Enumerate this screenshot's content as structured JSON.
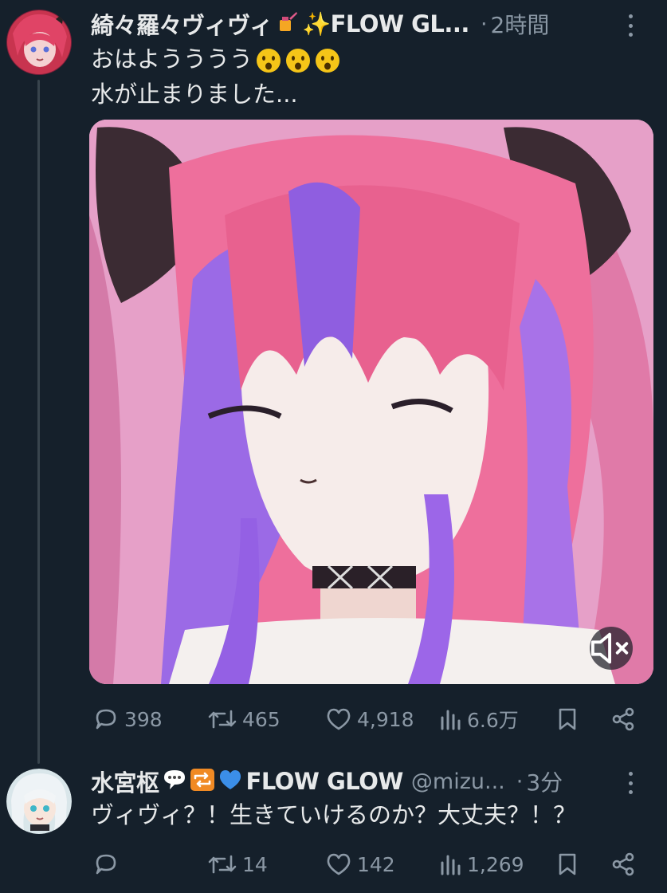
{
  "tweets": [
    {
      "display_name": "綺々羅々ヴィヴィ",
      "display_name_tail": "✨FLOW GL...",
      "handle": "",
      "dot": "·",
      "time": "2時間",
      "text_line1": "おはようううう",
      "text_line2": "水が止まりました...",
      "stats": {
        "replies": "398",
        "retweets": "465",
        "likes": "4,918",
        "views": "6.6万"
      }
    },
    {
      "display_name": "水宮枢",
      "display_name_tail": "FLOW GLOW",
      "handle": "@mizu...",
      "dot": "·",
      "time": "3分",
      "text_line1": "ヴィヴィ？！生きていけるのか？大丈夫？！？",
      "stats": {
        "replies": "",
        "retweets": "14",
        "likes": "142",
        "views": "1,269"
      }
    }
  ],
  "colors": {
    "background": "#15202b",
    "text": "#e7e9ea",
    "muted": "#8b98a5",
    "thread_line": "#38444d"
  },
  "icons": {
    "reply": "speech-bubble-icon",
    "retweet": "retweet-icon",
    "like": "heart-icon",
    "views": "bar-chart-icon",
    "bookmark": "bookmark-icon",
    "share": "share-icon",
    "mute": "speaker-muted-icon",
    "more": "more-vertical-icon"
  }
}
